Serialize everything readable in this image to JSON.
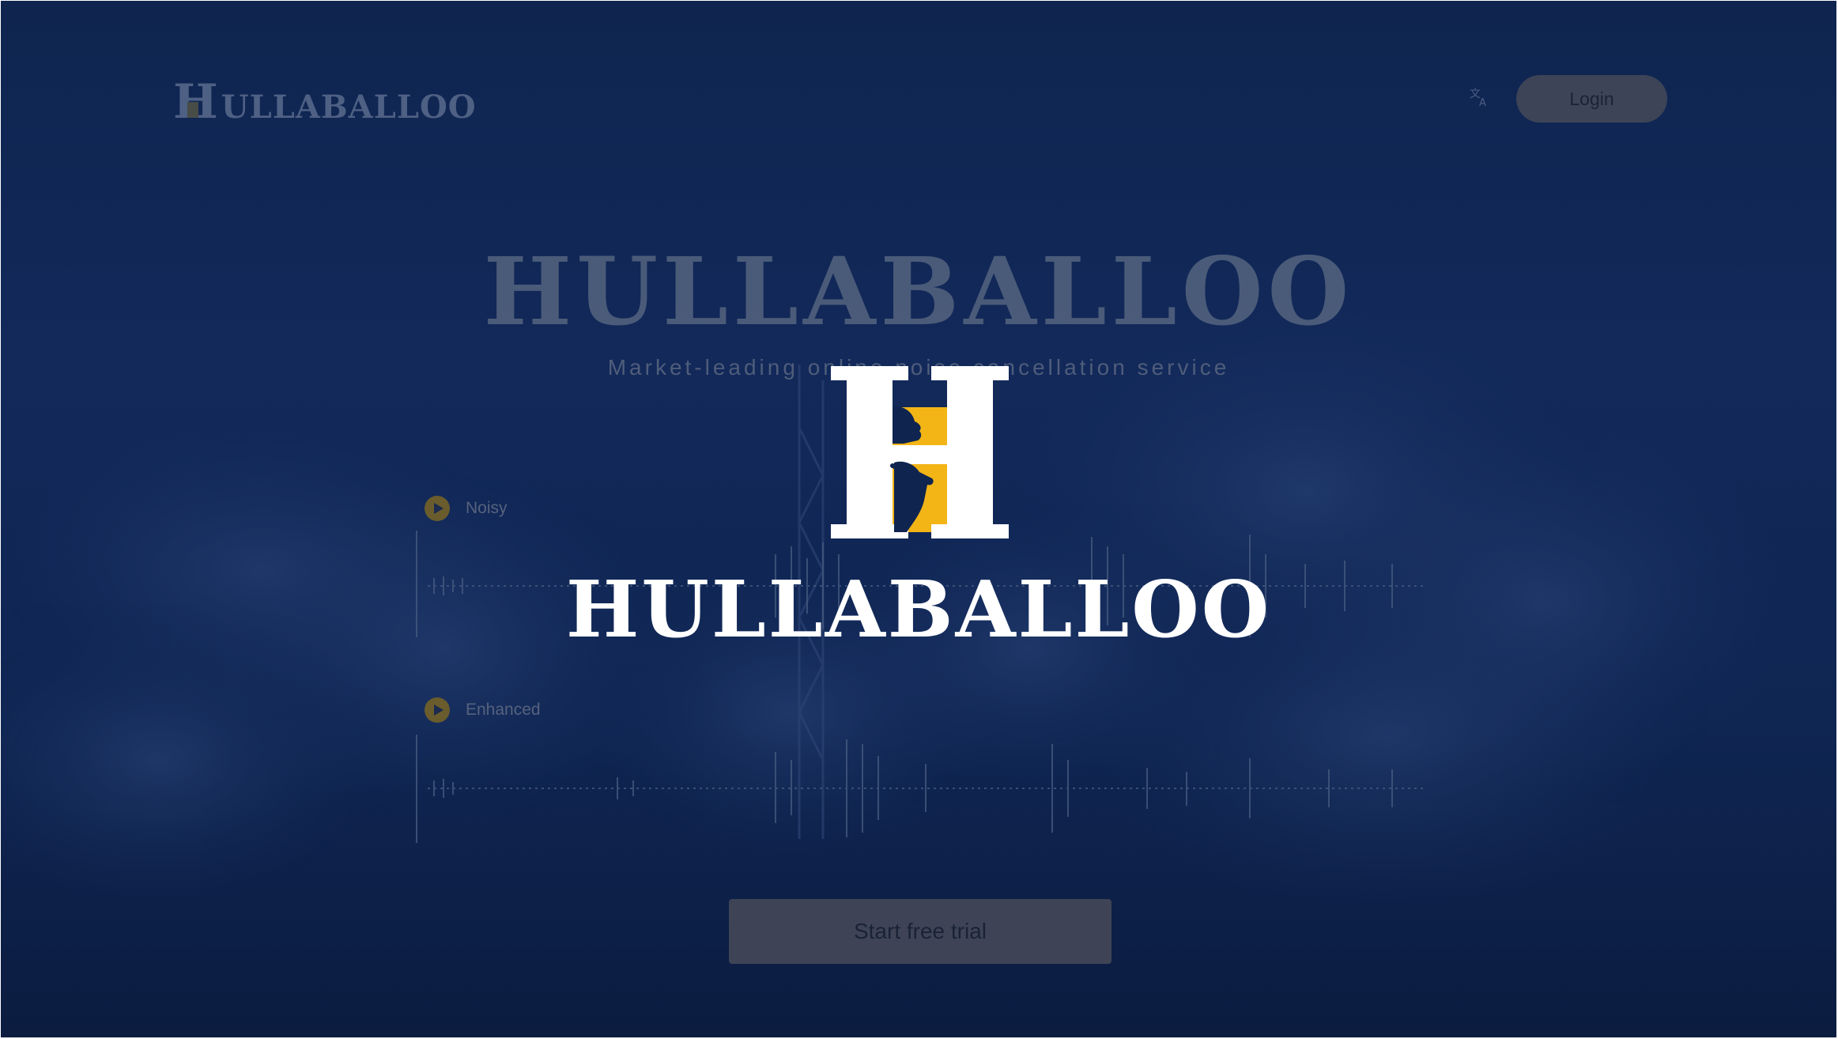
{
  "brand": {
    "header_wordmark": "ULLABALLOO",
    "header_mark": "H",
    "splash_wordmark": "HULLABALLOO",
    "colors": {
      "navy": "#12295a",
      "gold": "#f3b416",
      "white": "#ffffff"
    }
  },
  "header": {
    "language_icon": "translate-icon",
    "login_label": "Login"
  },
  "hero": {
    "title": "HULLABALLOO",
    "subtitle": "Market-leading online noise cancellation service"
  },
  "audio": {
    "noisy_label": "Noisy",
    "enhanced_label": "Enhanced",
    "play_icon": "play-icon"
  },
  "cta": {
    "start_label": "Start free trial"
  }
}
